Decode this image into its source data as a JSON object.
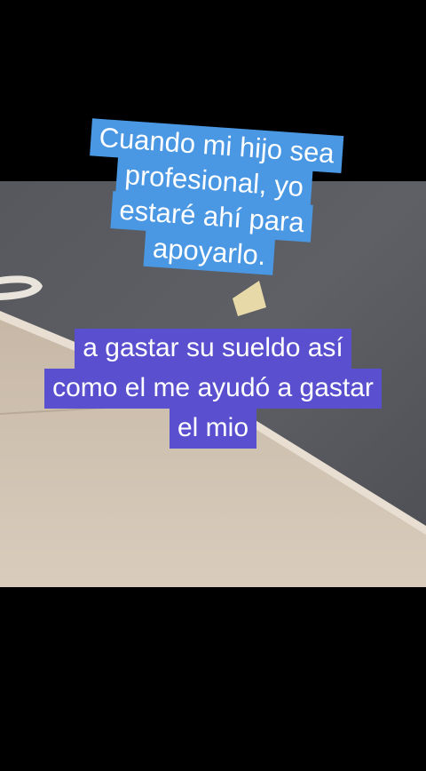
{
  "colors": {
    "background": "#000000",
    "caption_top_bg": "#4a97e3",
    "caption_bottom_bg": "#5a50cf",
    "caption_text": "#ffffff"
  },
  "captions": {
    "top": {
      "lines": [
        "Cuando mi hijo sea",
        "profesional, yo",
        "estaré ahí para",
        "apoyarlo."
      ]
    },
    "bottom": {
      "lines": [
        "a gastar su sueldo así",
        "como el me ayudó a gastar",
        "el mio"
      ]
    }
  }
}
